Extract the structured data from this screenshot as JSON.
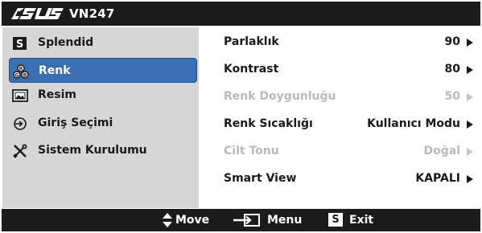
{
  "title": {
    "brand": "ASUS",
    "model": "VN247"
  },
  "sidebar": {
    "items": [
      {
        "label": "Splendid",
        "icon": "splendid-s-icon",
        "selected": false
      },
      {
        "label": "Renk",
        "icon": "color-palette-icon",
        "selected": true
      },
      {
        "label": "Resim",
        "icon": "picture-icon",
        "selected": false
      },
      {
        "label": "Giriş Seçimi",
        "icon": "input-select-icon",
        "selected": false
      },
      {
        "label": "Sistem Kurulumu",
        "icon": "tools-icon",
        "selected": false
      }
    ]
  },
  "main": {
    "rows": [
      {
        "label": "Parlaklık",
        "value": "90",
        "enabled": true
      },
      {
        "label": "Kontrast",
        "value": "80",
        "enabled": true
      },
      {
        "label": "Renk Doygunluğu",
        "value": "50",
        "enabled": false
      },
      {
        "label": "Renk Sıcaklığı",
        "value": "Kullanıcı Modu",
        "enabled": true
      },
      {
        "label": "Cilt Tonu",
        "value": "Doğal",
        "enabled": false
      },
      {
        "label": "Smart View",
        "value": "KAPALI",
        "enabled": true
      }
    ]
  },
  "footer": {
    "move": "Move",
    "menu": "Menu",
    "exit": "Exit",
    "exit_key": "S"
  },
  "colors": {
    "bar": "#1b1b1b",
    "sidebar": "#d6d6d6",
    "selected": "#3a6fb3",
    "disabled_text": "#b9b9b9"
  }
}
